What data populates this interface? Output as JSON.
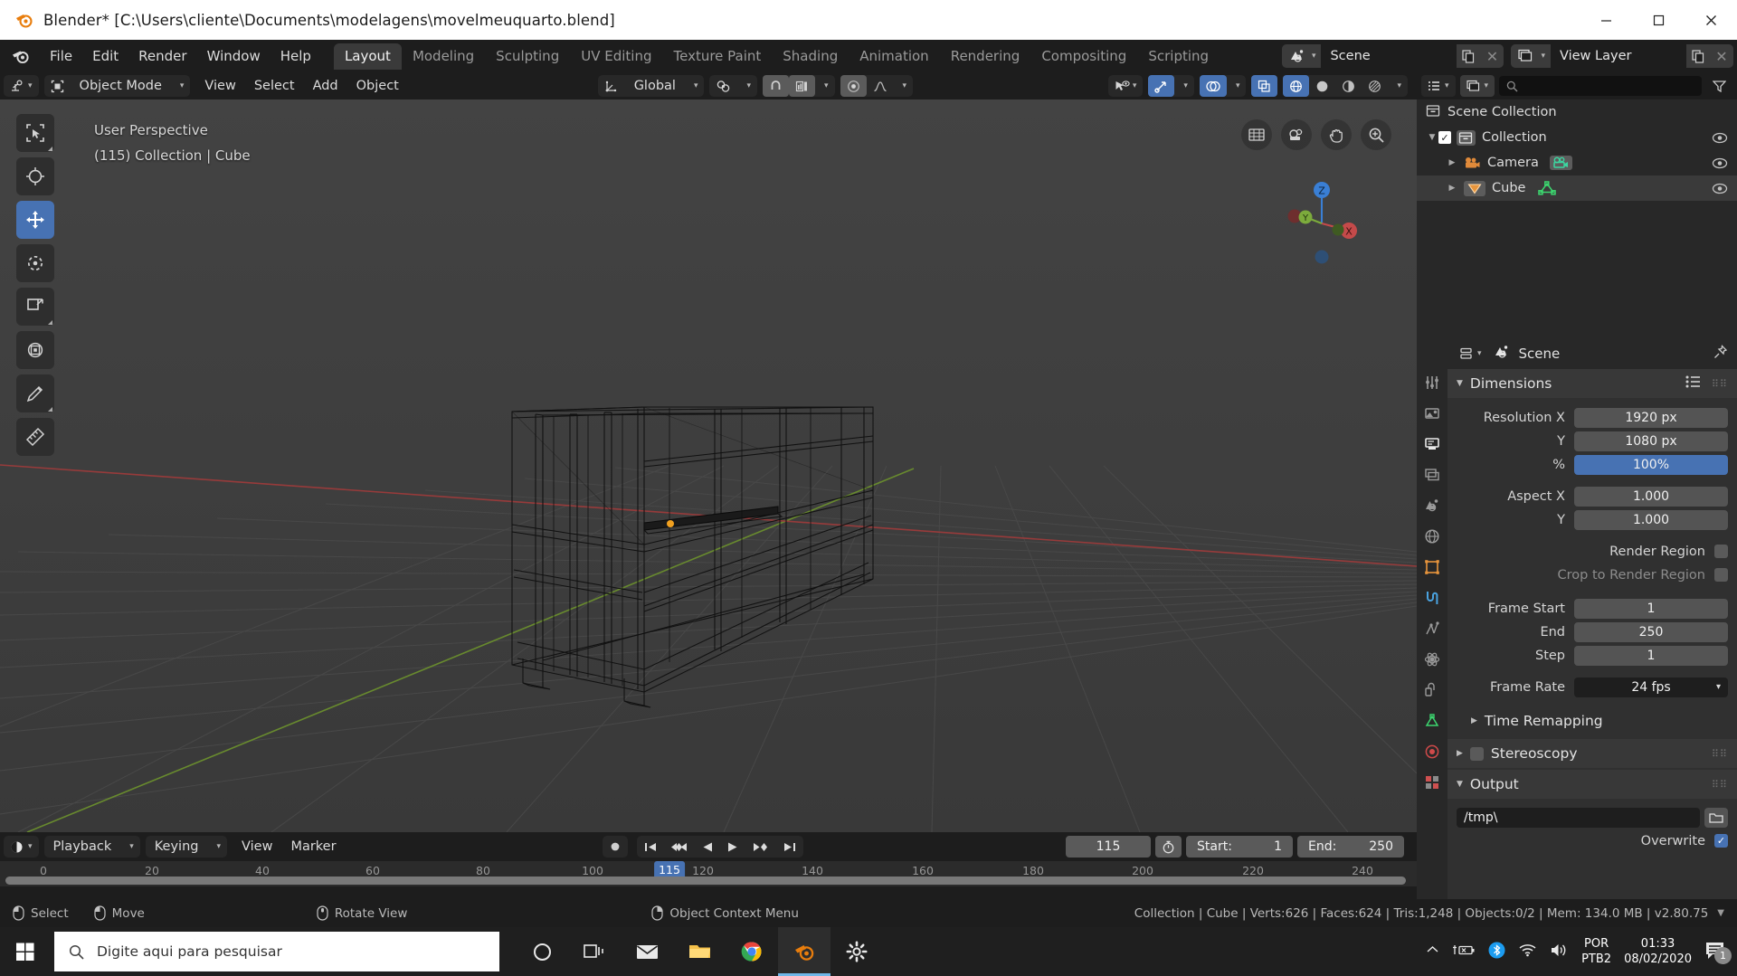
{
  "window": {
    "title": "Blender* [C:\\Users\\cliente\\Documents\\modelagens\\movelmeuquarto.blend]",
    "minimize": "─",
    "maximize": "☐",
    "close": "✕"
  },
  "topbar": {
    "menus": [
      "File",
      "Edit",
      "Render",
      "Window",
      "Help"
    ],
    "workspaces": [
      "Layout",
      "Modeling",
      "Sculpting",
      "UV Editing",
      "Texture Paint",
      "Shading",
      "Animation",
      "Rendering",
      "Compositing",
      "Scripting"
    ],
    "active_workspace": "Layout",
    "scene_name": "Scene",
    "view_layer_name": "View Layer"
  },
  "viewport": {
    "mode": "Object Mode",
    "menus": [
      "View",
      "Select",
      "Add",
      "Object"
    ],
    "transform_orientation": "Global",
    "overlay_line1": "User Perspective",
    "overlay_line2": "(115) Collection | Cube",
    "tools": [
      "select-box-tool",
      "cursor-tool",
      "move-tool",
      "rotate-tool",
      "scale-tool",
      "transform-tool",
      "annotate-tool",
      "measure-tool"
    ],
    "active_tool": "move-tool",
    "gizmo_axes": [
      "X",
      "Y",
      "Z"
    ]
  },
  "timeline": {
    "editor_menu": "timeline-editor-icon",
    "menus": [
      "Playback",
      "Keying",
      "View",
      "Marker"
    ],
    "current_frame": "115",
    "start_label": "Start:",
    "start_value": "1",
    "end_label": "End:",
    "end_value": "250",
    "ticks": [
      "0",
      "20",
      "40",
      "60",
      "80",
      "100",
      "120",
      "140",
      "160",
      "180",
      "200",
      "220",
      "240"
    ]
  },
  "outliner": {
    "search_placeholder": "",
    "rows": [
      {
        "name": "Scene Collection",
        "icon": "collection-icon",
        "indent": 0,
        "has_check": false,
        "has_disclosure": false,
        "eye": false
      },
      {
        "name": "Collection",
        "icon": "collection-icon",
        "indent": 1,
        "has_check": true,
        "has_disclosure": true,
        "eye": true
      },
      {
        "name": "Camera",
        "icon": "camera-icon",
        "indent": 2,
        "has_check": false,
        "has_disclosure": true,
        "eye": true,
        "data_icon": "camera-data-icon"
      },
      {
        "name": "Cube",
        "icon": "mesh-object-icon",
        "indent": 2,
        "has_check": false,
        "has_disclosure": true,
        "eye": true,
        "data_icon": "mesh-data-icon"
      }
    ]
  },
  "properties": {
    "breadcrumb": "Scene",
    "panels": {
      "dimensions_title": "Dimensions",
      "rows": [
        {
          "label": "Resolution X",
          "value": "1920 px",
          "style": "normal"
        },
        {
          "label": "Y",
          "value": "1080 px",
          "style": "normal"
        },
        {
          "label": "%",
          "value": "100%",
          "style": "blue"
        },
        {
          "label": "Aspect X",
          "value": "1.000",
          "style": "normal"
        },
        {
          "label": "Y",
          "value": "1.000",
          "style": "normal"
        }
      ],
      "checkbox_rows": [
        {
          "label": "Render Region",
          "checked": false,
          "dim": false
        },
        {
          "label": "Crop to Render Region",
          "checked": false,
          "dim": true
        }
      ],
      "frame_rows": [
        {
          "label": "Frame Start",
          "value": "1"
        },
        {
          "label": "End",
          "value": "250"
        },
        {
          "label": "Step",
          "value": "1"
        }
      ],
      "frame_rate_label": "Frame Rate",
      "frame_rate_value": "24 fps",
      "time_remapping": "Time Remapping",
      "stereoscopy": "Stereoscopy",
      "output_title": "Output",
      "output_path": "/tmp\\",
      "overwrite_label": "Overwrite",
      "overwrite_checked": true
    },
    "tabs": [
      "tool-icon",
      "render-icon",
      "output-icon",
      "view-layer-icon",
      "scene-icon",
      "world-icon",
      "object-icon",
      "modifier-icon",
      "particles-icon",
      "physics-icon",
      "constraints-icon",
      "data-icon",
      "material-icon",
      "texture-icon"
    ],
    "active_tab": "output-icon"
  },
  "statusbar": {
    "hints": [
      {
        "icon": "mouse-left-icon",
        "label": "Select"
      },
      {
        "icon": "mouse-move-icon",
        "label": "Move"
      },
      {
        "icon": "mouse-middle-icon",
        "label": "Rotate View"
      },
      {
        "icon": "mouse-right-icon",
        "label": "Object Context Menu"
      }
    ],
    "stats": "Collection | Cube | Verts:626 | Faces:624 | Tris:1,248 | Objects:0/2 | Mem: 134.0 MB | v2.80.75"
  },
  "taskbar": {
    "search_placeholder": "Digite aqui para pesquisar",
    "apps": [
      "cortana-icon",
      "task-view-icon",
      "mail-icon",
      "file-explorer-icon",
      "chrome-icon",
      "blender-icon",
      "settings-icon"
    ],
    "tray": {
      "chevron": "chevron-up-icon",
      "battery": "battery-icon",
      "bluetooth": "bluetooth-icon",
      "wifi": "wifi-icon",
      "volume": "volume-icon",
      "lang_line1": "POR",
      "lang_line2": "PTB2",
      "time": "01:33",
      "date": "08/02/2020",
      "notification_count": "1"
    }
  },
  "colors": {
    "accent_blue": "#4772b3",
    "bg_dark": "#1d1d1d",
    "viewport_bg": "#3c3c3c",
    "panel_bg": "#303030",
    "orange": "#e87d0d"
  }
}
